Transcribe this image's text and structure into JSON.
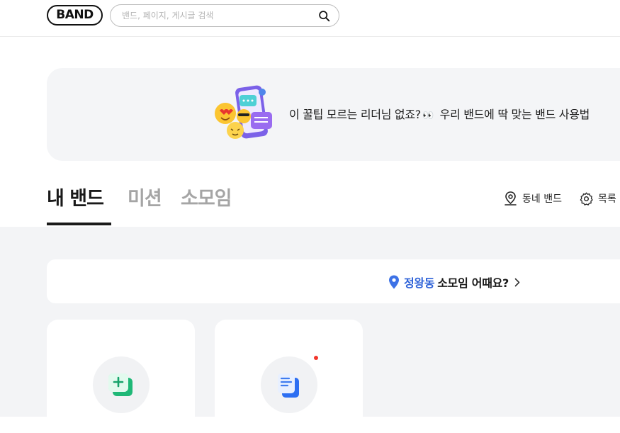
{
  "header": {
    "logo_text": "BAND",
    "search": {
      "placeholder": "밴드, 페이지, 게시글 검색",
      "value": "",
      "icon": "search-icon"
    }
  },
  "banner": {
    "text": "이 꿀팁 모르는 리더님 없죠?",
    "text_after": "우리 밴드에 딱 맞는 밴드 사용법",
    "emoji": "👀",
    "illustration": "phone-emoji-illustration"
  },
  "tabs": [
    {
      "label": "내 밴드",
      "active": true
    },
    {
      "label": "미션",
      "active": false
    },
    {
      "label": "소모임",
      "active": false
    }
  ],
  "actions": {
    "neighborhood": {
      "label": "동네 밴드",
      "icon": "map-pin-icon"
    },
    "list": {
      "label": "목록",
      "icon": "gear-icon"
    }
  },
  "suggest": {
    "place": "정왕동",
    "rest": "소모임 어때요?",
    "icon": "location-pin-icon"
  },
  "cards": [
    {
      "icon": "create-band-icon",
      "accent": "#2ecf8a",
      "new_dot": false
    },
    {
      "icon": "document-icon",
      "accent": "#3f7cf0",
      "new_dot": true
    }
  ],
  "colors": {
    "brand": "#111111",
    "link_blue": "#2f63d8",
    "new_dot": "#f2362c",
    "page_gray": "#f3f4f6"
  }
}
